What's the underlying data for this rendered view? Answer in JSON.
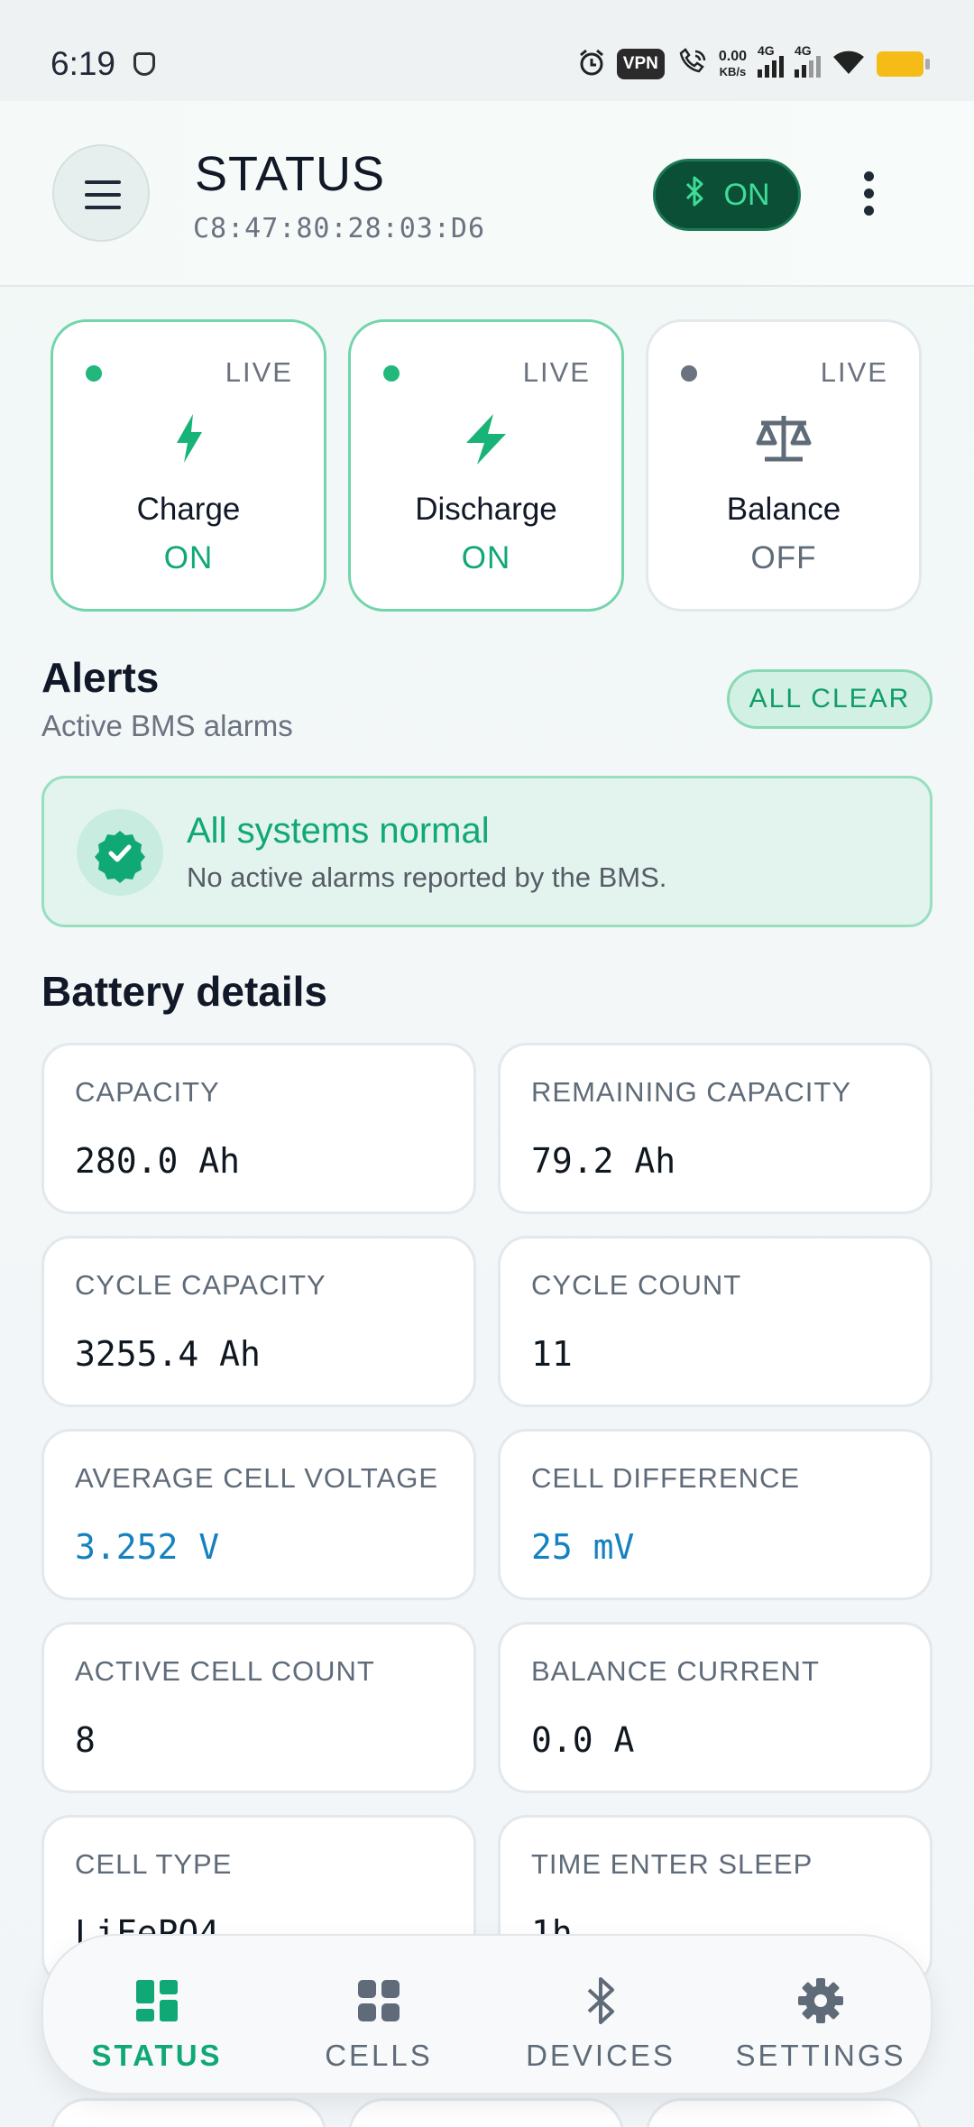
{
  "statusbar": {
    "time": "6:19",
    "vpn": "VPN",
    "speed_value": "0.00",
    "speed_unit": "KB/s",
    "sim1": "4G",
    "sim2": "4G"
  },
  "header": {
    "title": "STATUS",
    "mac": "C8:47:80:28:03:D6",
    "bt_state": "ON"
  },
  "states": [
    {
      "live": "LIVE",
      "label": "Charge",
      "value": "ON"
    },
    {
      "live": "LIVE",
      "label": "Discharge",
      "value": "ON"
    },
    {
      "live": "LIVE",
      "label": "Balance",
      "value": "OFF"
    }
  ],
  "alerts": {
    "title": "Alerts",
    "subtitle": "Active BMS alarms",
    "badge": "ALL CLEAR",
    "card_title": "All systems normal",
    "card_message": "No active alarms reported by the BMS."
  },
  "details": {
    "title": "Battery details",
    "tiles": [
      {
        "label": "CAPACITY",
        "value": "280.0 Ah"
      },
      {
        "label": "REMAINING CAPACITY",
        "value": "79.2 Ah"
      },
      {
        "label": "CYCLE CAPACITY",
        "value": "3255.4 Ah"
      },
      {
        "label": "CYCLE COUNT",
        "value": "11"
      },
      {
        "label": "AVERAGE CELL VOLTAGE",
        "value": "3.252 V"
      },
      {
        "label": "CELL DIFFERENCE",
        "value": "25 mV"
      },
      {
        "label": "ACTIVE CELL COUNT",
        "value": "8"
      },
      {
        "label": "BALANCE CURRENT",
        "value": "0.0 A"
      },
      {
        "label": "CELL TYPE",
        "value": "LiFePO4"
      },
      {
        "label": "TIME ENTER SLEEP",
        "value": "1h"
      }
    ]
  },
  "nav": [
    {
      "label": "STATUS",
      "icon": "dashboard-icon",
      "active": true
    },
    {
      "label": "CELLS",
      "icon": "cells-grid-icon",
      "active": false
    },
    {
      "label": "DEVICES",
      "icon": "bluetooth-icon",
      "active": false
    },
    {
      "label": "SETTINGS",
      "icon": "gear-icon",
      "active": false
    }
  ],
  "colors": {
    "accent": "#10a874",
    "bt_pill_bg": "#0b4f36",
    "value_blue": "#1681c0",
    "alarm_alert_dot_off": "#6b7280"
  }
}
